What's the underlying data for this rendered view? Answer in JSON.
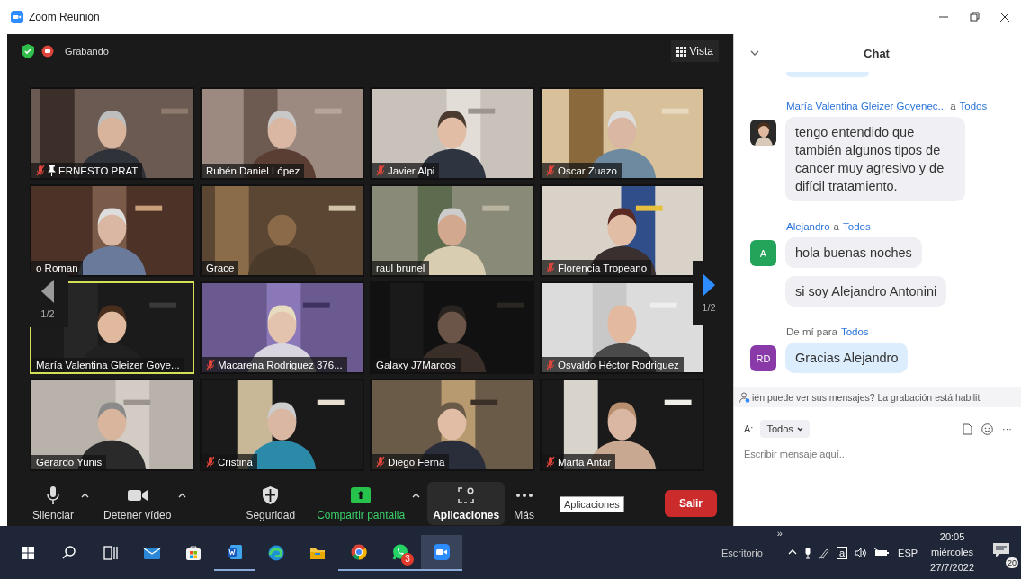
{
  "window": {
    "title": "Zoom Reunión"
  },
  "meeting_bar": {
    "recording_label": "Grabando",
    "view_button": "Vista"
  },
  "participants": [
    {
      "name": "ERNESTO PRAT",
      "muted": true,
      "pinned": true,
      "speaking": false
    },
    {
      "name": "Rubén Daniel López",
      "muted": false,
      "pinned": false,
      "speaking": false
    },
    {
      "name": "Javier Alpi",
      "muted": true,
      "pinned": false,
      "speaking": false
    },
    {
      "name": "Oscar Zuazo",
      "muted": true,
      "pinned": false,
      "speaking": false
    },
    {
      "name": "o Roman",
      "muted": false,
      "pinned": false,
      "speaking": false
    },
    {
      "name": "Grace",
      "muted": false,
      "pinned": false,
      "speaking": false
    },
    {
      "name": "raul brunel",
      "muted": false,
      "pinned": false,
      "speaking": false
    },
    {
      "name": "Florencia Tropeano",
      "muted": true,
      "pinned": false,
      "speaking": false
    },
    {
      "name": "María Valentina Gleizer Goye...",
      "muted": false,
      "pinned": false,
      "speaking": true
    },
    {
      "name": "Macarena Rodriguez 376...",
      "muted": true,
      "pinned": false,
      "speaking": false
    },
    {
      "name": "Galaxy J7Marcos",
      "muted": false,
      "pinned": false,
      "speaking": false
    },
    {
      "name": "Osvaldo Héctor Rodriguez",
      "muted": true,
      "pinned": false,
      "speaking": false
    },
    {
      "name": "Gerardo Yunis",
      "muted": false,
      "pinned": false,
      "speaking": false
    },
    {
      "name": "Cristina",
      "muted": true,
      "pinned": false,
      "speaking": false
    },
    {
      "name": "Diego Ferna",
      "muted": true,
      "pinned": false,
      "speaking": false
    },
    {
      "name": "Marta Antar",
      "muted": true,
      "pinned": false,
      "speaking": false
    }
  ],
  "pager": {
    "left": "1/2",
    "right": "1/2"
  },
  "toolbar": {
    "items": [
      {
        "kind": "mic",
        "label": "Silenciar",
        "caret": true,
        "hovered": false
      },
      {
        "kind": "camera",
        "label": "Detener vídeo",
        "caret": true,
        "hovered": false
      },
      {
        "kind": "security",
        "label": "Seguridad",
        "caret": false,
        "hovered": false
      },
      {
        "kind": "share",
        "label": "Compartir pantalla",
        "caret": true,
        "hovered": false
      },
      {
        "kind": "apps",
        "label": "Aplicaciones",
        "caret": false,
        "hovered": true
      },
      {
        "kind": "more",
        "label": "Más",
        "caret": false,
        "hovered": false
      }
    ],
    "tooltip": "Aplicaciones",
    "leave_button": "Salir"
  },
  "chat": {
    "title": "Chat",
    "messages": [
      {
        "sender": "María Valentina Gleizer Goyenec...",
        "connector": "a",
        "recipient": "Todos",
        "own": false,
        "avatar": {
          "kind": "picture"
        },
        "bubbles": [
          "tengo entendido que también algunos tipos de cancer muy agresivo y de difícil tratamiento."
        ]
      },
      {
        "sender": "Alejandro",
        "connector": "a",
        "recipient": "Todos",
        "own": false,
        "avatar": {
          "kind": "initials",
          "text": "A",
          "color": "#22a45a"
        },
        "bubbles": [
          "hola buenas noches",
          "si soy Alejandro Antonini"
        ]
      },
      {
        "connector": "De mí para",
        "recipient": "Todos",
        "own": true,
        "avatar": {
          "kind": "initials",
          "text": "RD",
          "color": "#8a3aa8"
        },
        "bubbles": [
          "Gracias Alejandro"
        ]
      }
    ],
    "notice": "ién puede ver sus mensajes? La grabación está habilit",
    "compose": {
      "to_label": "A:",
      "recipient": "Todos",
      "more": "···",
      "placeholder": "Escribir mensaje aquí..."
    }
  },
  "taskbar": {
    "apps": [
      {
        "kind": "start",
        "running": false,
        "active": false
      },
      {
        "kind": "search",
        "running": false,
        "active": false
      },
      {
        "kind": "taskview",
        "running": false,
        "active": false
      },
      {
        "kind": "mail",
        "running": false,
        "active": false
      },
      {
        "kind": "store",
        "running": false,
        "active": false
      },
      {
        "kind": "word",
        "running": true,
        "active": false
      },
      {
        "kind": "edge",
        "running": false,
        "active": false
      },
      {
        "kind": "files",
        "running": false,
        "active": false
      },
      {
        "kind": "chrome",
        "running": true,
        "active": false
      },
      {
        "kind": "whatsapp",
        "running": true,
        "active": false,
        "badge": "3"
      },
      {
        "kind": "zoom",
        "running": true,
        "active": true
      }
    ],
    "desktop_label": "Escritorio",
    "overflow": "»",
    "tray": [
      {
        "kind": "chevron"
      },
      {
        "kind": "mic"
      },
      {
        "kind": "pen"
      },
      {
        "kind": "letter",
        "text": "a"
      },
      {
        "kind": "speaker"
      },
      {
        "kind": "battery"
      }
    ],
    "language": "ESP",
    "time": "20:05",
    "day": "miércoles",
    "date": "27/7/2022",
    "notifications": "20"
  }
}
